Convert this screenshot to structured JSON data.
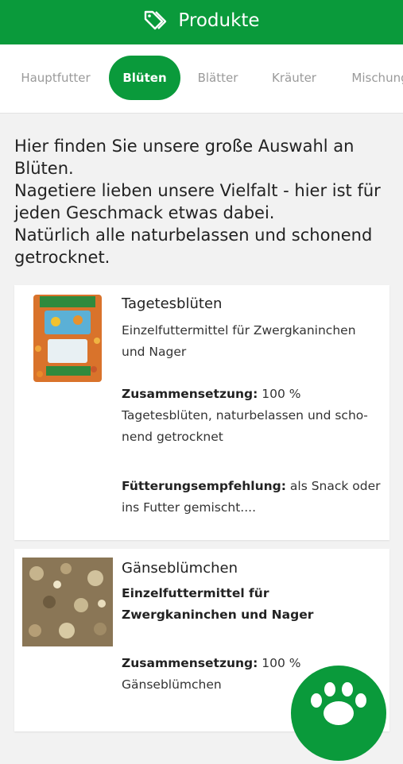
{
  "header": {
    "title": "Produkte",
    "icon": "tag-icon"
  },
  "tabs": [
    {
      "label": "Hauptfutter"
    },
    {
      "label": "Blüten"
    },
    {
      "label": "Blätter"
    },
    {
      "label": "Kräuter"
    },
    {
      "label": "Mischung"
    }
  ],
  "intro": {
    "line1": "Hier finden Sie unsere große Auswahl an Blüten.",
    "line2": "Nagetiere lieben unsere Vielfalt - hier ist für jeden Geschmack etwas dabei.",
    "line3": "Natürlich alle naturbelassen und schonend getrocknet."
  },
  "products": [
    {
      "name": "Tagetesblüten",
      "subtitle": "Einzelfuttermittel für Zwergkaninchen und Nager",
      "composition_label": "Zusammensetzung:",
      "composition": "100 % Tagetesblüten, naturbelassen und scho­nend getrocknet",
      "feeding_label": "Fütterungsempfehlung:",
      "feeding": "als Snack oder ins Futter gemischt...."
    },
    {
      "name": "Gänseblümchen",
      "subtitle": "Einzelfuttermittel für Zwergkaninchen und Nager",
      "composition_label": "Zusammensetzung:",
      "composition": "100 % Gänseblümchen"
    }
  ],
  "colors": {
    "brand_green": "#0a9a3b"
  },
  "fab": {
    "icon": "paw-icon"
  }
}
